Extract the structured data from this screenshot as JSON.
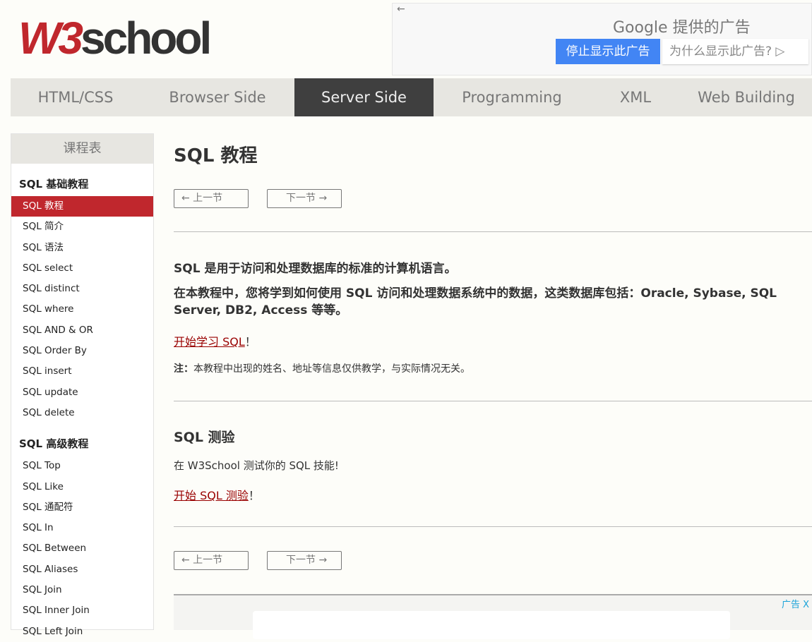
{
  "logo": {
    "w3": "W3",
    "school": "school"
  },
  "ad": {
    "back": "←",
    "by": "Google 提供的广告",
    "stop": "停止显示此广告",
    "why": "为什么显示此广告? ▷"
  },
  "nav": [
    "HTML/CSS",
    "Browser Side",
    "Server Side",
    "Programming",
    "XML",
    "Web Building"
  ],
  "sidebar": {
    "header": "课程表",
    "sec1": "SQL 基础教程",
    "items1": [
      "SQL 教程",
      "SQL 简介",
      "SQL 语法",
      "SQL select",
      "SQL distinct",
      "SQL where",
      "SQL AND & OR",
      "SQL Order By",
      "SQL insert",
      "SQL update",
      "SQL delete"
    ],
    "sec2": "SQL 高级教程",
    "items2": [
      "SQL Top",
      "SQL Like",
      "SQL 通配符",
      "SQL In",
      "SQL Between",
      "SQL Aliases",
      "SQL Join",
      "SQL Inner Join",
      "SQL Left Join"
    ]
  },
  "main": {
    "title": "SQL 教程",
    "prev": "← 上一节",
    "next": "下一节 →",
    "p1": "SQL 是用于访问和处理数据库的标准的计算机语言。",
    "p2": "在本教程中，您将学到如何使用 SQL 访问和处理数据系统中的数据，这类数据库包括：Oracle, Sybase, SQL Server, DB2, Access 等等。",
    "link1": "开始学习 SQL",
    "excl": "！",
    "note_label": "注：",
    "note": "本教程中出现的姓名、地址等信息仅供教学，与实际情况无关。",
    "quiz_title": "SQL 测验",
    "quiz_text": "在 W3School 测试你的 SQL 技能!",
    "link2": "开始 SQL 测验"
  },
  "ad2": {
    "label": "广告 X"
  }
}
